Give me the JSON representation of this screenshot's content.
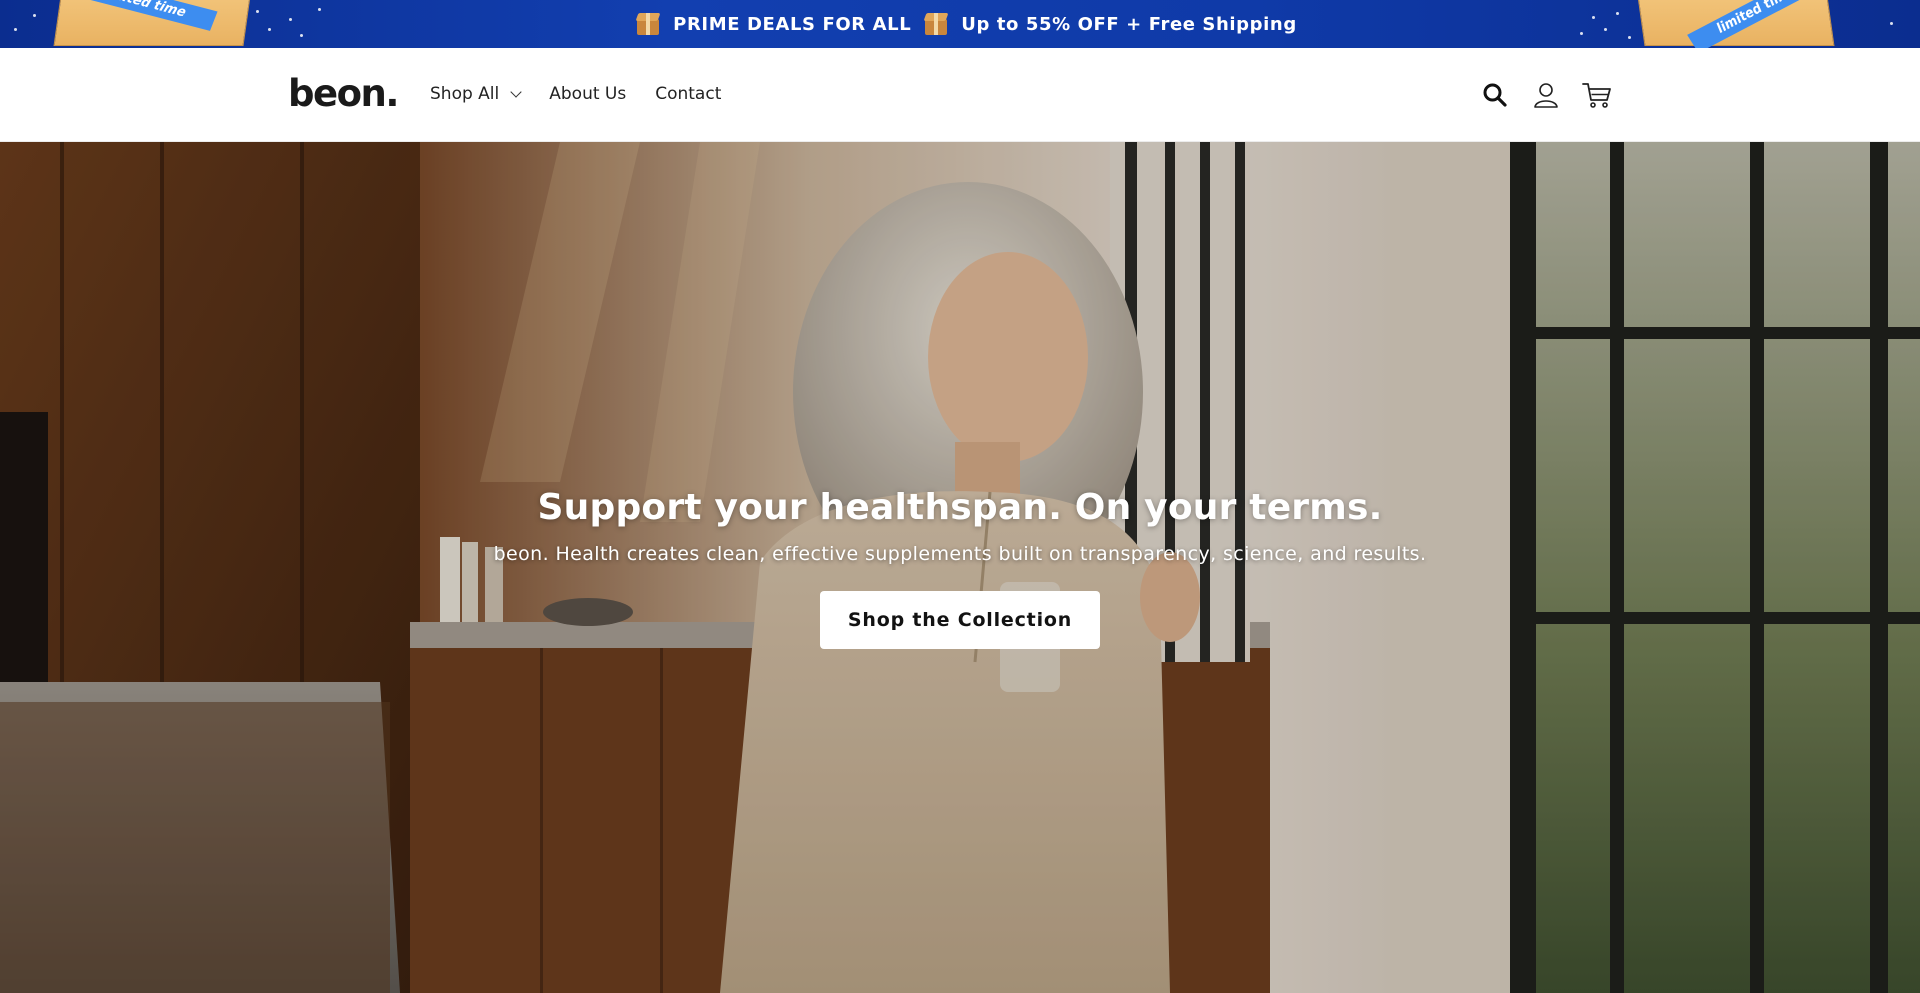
{
  "announcement": {
    "text_left": "PRIME DEALS FOR ALL",
    "text_right": "Up to 55% OFF + Free Shipping",
    "icon": "package-icon",
    "promo_tape_text": "limited time",
    "colors": {
      "background": "#123fb0",
      "text": "#ffffff"
    }
  },
  "header": {
    "logo": "beon.",
    "nav": [
      {
        "label": "Shop All",
        "has_dropdown": true
      },
      {
        "label": "About Us",
        "has_dropdown": false
      },
      {
        "label": "Contact",
        "has_dropdown": false
      }
    ],
    "icons": [
      "search-icon",
      "account-icon",
      "cart-icon"
    ]
  },
  "hero": {
    "title": "Support your healthspan. On your terms.",
    "subtitle": "beon. Health creates clean, effective supplements built on transparency, science, and results.",
    "cta_label": "Shop the Collection",
    "colors": {
      "text": "#ffffff",
      "button_bg": "#ffffff",
      "button_text": "#121212"
    }
  }
}
